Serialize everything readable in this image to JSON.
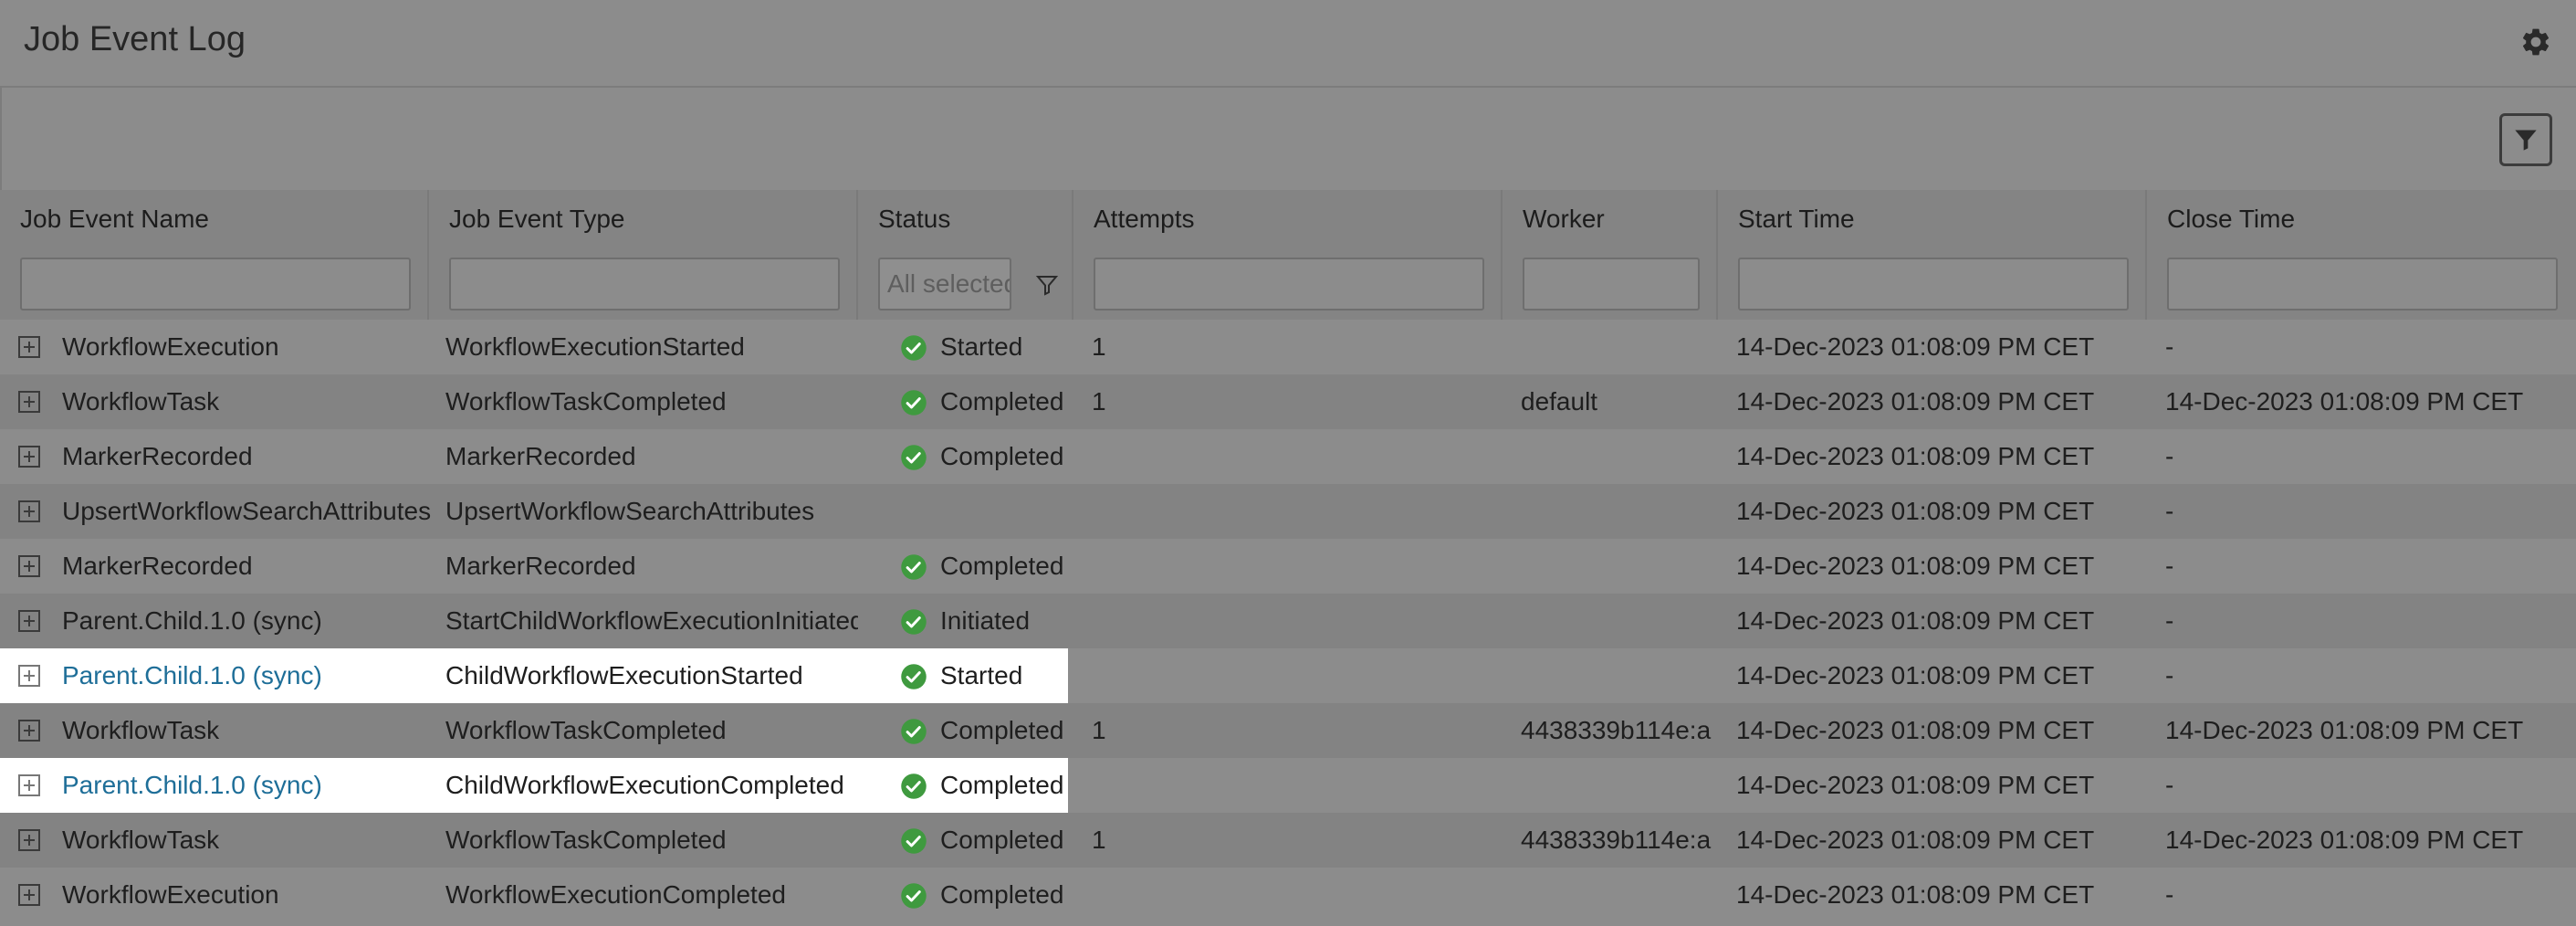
{
  "header": {
    "title": "Job Event Log",
    "settings_icon": "gear-icon",
    "filter_icon": "funnel-icon"
  },
  "columns": [
    {
      "key": "name",
      "label": "Job Event Name"
    },
    {
      "key": "type",
      "label": "Job Event Type"
    },
    {
      "key": "status",
      "label": "Status"
    },
    {
      "key": "attempts",
      "label": "Attempts"
    },
    {
      "key": "worker",
      "label": "Worker"
    },
    {
      "key": "start",
      "label": "Start Time"
    },
    {
      "key": "close",
      "label": "Close Time"
    }
  ],
  "filters": {
    "name": "",
    "type": "",
    "status_placeholder": "All selected",
    "attempts": "",
    "worker": "",
    "start": "",
    "close": ""
  },
  "colors": {
    "background": "#8c8c8c",
    "highlight": "#ffffff",
    "link": "#1e6e98",
    "status_ok": "#3f9a3f"
  },
  "rows": [
    {
      "name": "WorkflowExecution",
      "type": "WorkflowExecutionStarted",
      "status": "Started",
      "attempts": "1",
      "worker": "",
      "start": "14-Dec-2023 01:08:09 PM CET",
      "close": "-",
      "highlighted": false,
      "link": false
    },
    {
      "name": "WorkflowTask",
      "type": "WorkflowTaskCompleted",
      "status": "Completed",
      "attempts": "1",
      "worker": "default",
      "start": "14-Dec-2023 01:08:09 PM CET",
      "close": "14-Dec-2023 01:08:09 PM CET",
      "highlighted": false,
      "link": false
    },
    {
      "name": "MarkerRecorded",
      "type": "MarkerRecorded",
      "status": "Completed",
      "attempts": "",
      "worker": "",
      "start": "14-Dec-2023 01:08:09 PM CET",
      "close": "-",
      "highlighted": false,
      "link": false
    },
    {
      "name": "UpsertWorkflowSearchAttributes",
      "type": "UpsertWorkflowSearchAttributes",
      "status": "",
      "attempts": "",
      "worker": "",
      "start": "14-Dec-2023 01:08:09 PM CET",
      "close": "-",
      "highlighted": false,
      "link": false
    },
    {
      "name": "MarkerRecorded",
      "type": "MarkerRecorded",
      "status": "Completed",
      "attempts": "",
      "worker": "",
      "start": "14-Dec-2023 01:08:09 PM CET",
      "close": "-",
      "highlighted": false,
      "link": false
    },
    {
      "name": "Parent.Child.1.0 (sync)",
      "type": "StartChildWorkflowExecutionInitiated",
      "status": "Initiated",
      "attempts": "",
      "worker": "",
      "start": "14-Dec-2023 01:08:09 PM CET",
      "close": "-",
      "highlighted": false,
      "link": false
    },
    {
      "name": "Parent.Child.1.0 (sync)",
      "type": "ChildWorkflowExecutionStarted",
      "status": "Started",
      "attempts": "",
      "worker": "",
      "start": "14-Dec-2023 01:08:09 PM CET",
      "close": "-",
      "highlighted": true,
      "link": true
    },
    {
      "name": "WorkflowTask",
      "type": "WorkflowTaskCompleted",
      "status": "Completed",
      "attempts": "1",
      "worker": "4438339b114e:a",
      "start": "14-Dec-2023 01:08:09 PM CET",
      "close": "14-Dec-2023 01:08:09 PM CET",
      "highlighted": false,
      "link": false
    },
    {
      "name": "Parent.Child.1.0 (sync)",
      "type": "ChildWorkflowExecutionCompleted",
      "status": "Completed",
      "attempts": "",
      "worker": "",
      "start": "14-Dec-2023 01:08:09 PM CET",
      "close": "-",
      "highlighted": true,
      "link": true
    },
    {
      "name": "WorkflowTask",
      "type": "WorkflowTaskCompleted",
      "status": "Completed",
      "attempts": "1",
      "worker": "4438339b114e:a",
      "start": "14-Dec-2023 01:08:09 PM CET",
      "close": "14-Dec-2023 01:08:09 PM CET",
      "highlighted": false,
      "link": false
    },
    {
      "name": "WorkflowExecution",
      "type": "WorkflowExecutionCompleted",
      "status": "Completed",
      "attempts": "",
      "worker": "",
      "start": "14-Dec-2023 01:08:09 PM CET",
      "close": "-",
      "highlighted": false,
      "link": false
    }
  ]
}
